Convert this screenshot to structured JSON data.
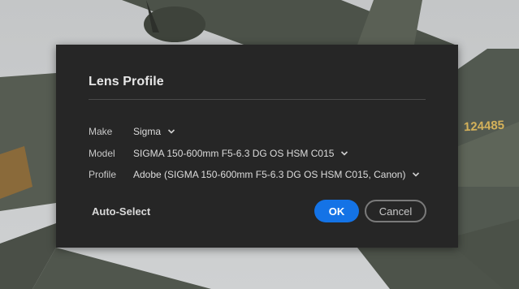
{
  "dialog": {
    "title": "Lens Profile",
    "fields": [
      {
        "label": "Make",
        "value": "Sigma"
      },
      {
        "label": "Model",
        "value": "SIGMA 150-600mm F5-6.3 DG OS HSM C015"
      },
      {
        "label": "Profile",
        "value": "Adobe (SIGMA 150-600mm F5-6.3 DG OS HSM C015, Canon)"
      }
    ],
    "auto_select_label": "Auto-Select",
    "ok_label": "OK",
    "cancel_label": "Cancel"
  },
  "background": {
    "aircraft_serial": "124485"
  },
  "colors": {
    "accent": "#1473e6",
    "dialog_bg": "#262626"
  },
  "icons": {
    "dropdown": "chevron-down-icon"
  }
}
